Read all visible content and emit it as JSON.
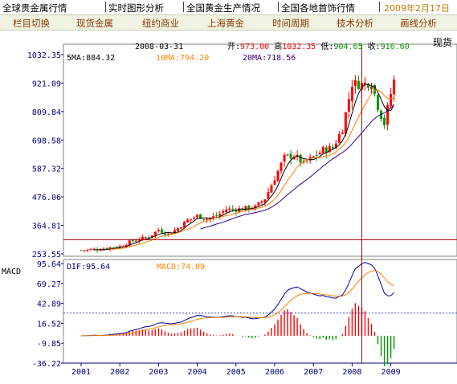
{
  "top_tabs": [
    "全球贵金属行情",
    "实时图形分析",
    "全国黄金生产情况",
    "全国各地首饰行情"
  ],
  "top_date": "2009年2月17日",
  "nav_tabs": [
    "栏目切换",
    "现货金属",
    "纽约商业",
    "上海黄金",
    "时间周期",
    "技术分析",
    "画线分析"
  ],
  "right_label": "现货",
  "colors": {
    "up": "#ff0000",
    "down": "#009900",
    "ma5": "#000000",
    "ma10": "#ff8000",
    "ma20": "#330080",
    "dif": "#0000a0",
    "dea": "#ff8000",
    "crosshair": "#990000",
    "axis": "#000080",
    "grid": "#c0c0c0"
  },
  "chart_data": {
    "type": "candlestick",
    "date": "2008-03-31",
    "ohlc_labels": {
      "open_label": "开:",
      "open": "973.00",
      "high_label": "高",
      "high": "1032.35",
      "low_label": "低:",
      "low": "904.65",
      "close_label": "收:",
      "close": "916.60"
    },
    "ma_labels": {
      "ma5": "5MA:884.32",
      "ma10": "10MA:794.20",
      "ma20": "20MA:718.56"
    },
    "price_ticks": [
      "1032.35",
      "921.09",
      "809.84",
      "698.58",
      "587.32",
      "476.06",
      "364.81",
      "253.55"
    ],
    "price_range": [
      253.55,
      1032.35
    ],
    "crosshair_price": 309,
    "macd_labels": {
      "title": "MACD",
      "dif": "DIF:95.64",
      "macd": "MACD:74.09"
    },
    "macd_ticks": [
      "95.64",
      "69.27",
      "42.89",
      "16.52",
      "-9.85",
      "-36.22"
    ],
    "macd_range": [
      -36.22,
      95.64
    ],
    "macd_dotted_level": 30,
    "x_labels": [
      "2001",
      "2002",
      "2003",
      "2004",
      "2005",
      "2006",
      "2007",
      "2008",
      "2009"
    ],
    "crosshair_date": "2008-03-31",
    "close_series": [
      {
        "t": 2001.0,
        "v": 268
      },
      {
        "t": 2001.5,
        "v": 272
      },
      {
        "t": 2001.75,
        "v": 279
      },
      {
        "t": 2002.0,
        "v": 282
      },
      {
        "t": 2002.25,
        "v": 300
      },
      {
        "t": 2002.5,
        "v": 312
      },
      {
        "t": 2002.75,
        "v": 320
      },
      {
        "t": 2003.0,
        "v": 348
      },
      {
        "t": 2003.25,
        "v": 330
      },
      {
        "t": 2003.5,
        "v": 354
      },
      {
        "t": 2003.75,
        "v": 385
      },
      {
        "t": 2004.0,
        "v": 402
      },
      {
        "t": 2004.25,
        "v": 390
      },
      {
        "t": 2004.5,
        "v": 402
      },
      {
        "t": 2004.75,
        "v": 428
      },
      {
        "t": 2005.0,
        "v": 427
      },
      {
        "t": 2005.25,
        "v": 432
      },
      {
        "t": 2005.5,
        "v": 436
      },
      {
        "t": 2005.75,
        "v": 470
      },
      {
        "t": 2006.0,
        "v": 550
      },
      {
        "t": 2006.25,
        "v": 630
      },
      {
        "t": 2006.5,
        "v": 640
      },
      {
        "t": 2006.75,
        "v": 605
      },
      {
        "t": 2007.0,
        "v": 632
      },
      {
        "t": 2007.25,
        "v": 660
      },
      {
        "t": 2007.5,
        "v": 668
      },
      {
        "t": 2007.75,
        "v": 744
      },
      {
        "t": 2008.0,
        "v": 920
      },
      {
        "t": 2008.25,
        "v": 916
      },
      {
        "t": 2008.5,
        "v": 925
      },
      {
        "t": 2008.67,
        "v": 830
      },
      {
        "t": 2008.83,
        "v": 760
      },
      {
        "t": 2009.0,
        "v": 880
      },
      {
        "t": 2009.1,
        "v": 940
      }
    ]
  }
}
